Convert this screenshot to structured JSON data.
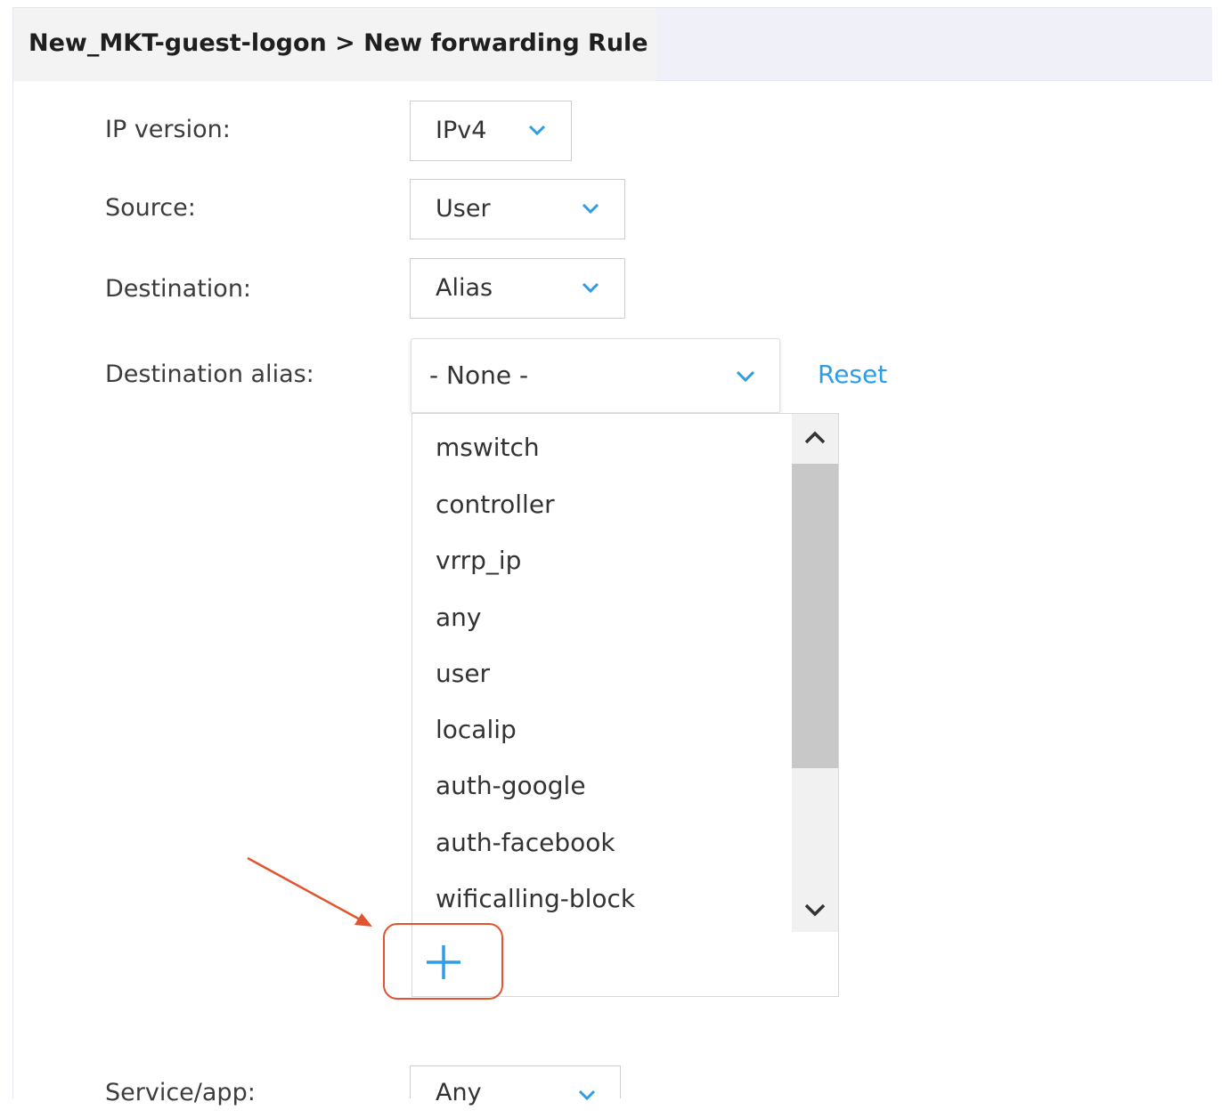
{
  "header": {
    "title": "New_MKT-guest-logon > New forwarding Rule"
  },
  "form": {
    "ip_version": {
      "label": "IP version:",
      "value": "IPv4"
    },
    "source": {
      "label": "Source:",
      "value": "User"
    },
    "destination": {
      "label": "Destination:",
      "value": "Alias"
    },
    "destination_alias": {
      "label": "Destination alias:",
      "value": "- None -",
      "reset_label": "Reset"
    },
    "service_app": {
      "label": "Service/app:",
      "value": "Any"
    }
  },
  "alias_list": {
    "options": [
      "mswitch",
      "controller",
      "vrrp_ip",
      "any",
      "user",
      "localip",
      "auth-google",
      "auth-facebook",
      "wificalling-block"
    ],
    "add_icon": "plus-icon"
  },
  "icons": {
    "dropdown": "chevron-down-icon",
    "scroll_up": "chevron-up-icon",
    "scroll_down": "chevron-down-icon"
  },
  "colors": {
    "accent": "#2f9ce6",
    "annotation": "#e0552f",
    "header_bg": "#f0f1f8"
  }
}
